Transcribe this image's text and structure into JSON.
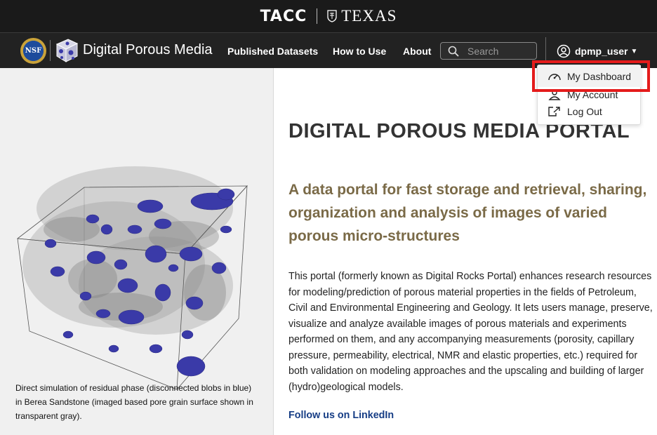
{
  "topbar": {
    "tacc_logo": "TACC",
    "texas_logo": "TEXAS"
  },
  "nav": {
    "nsf_logo": "NSF",
    "brand_title": "Digital Porous Media",
    "links": {
      "published": "Published Datasets",
      "howto": "How to Use",
      "about": "About"
    },
    "search": {
      "placeholder": "Search"
    },
    "user": "dpmp_user"
  },
  "dropdown": {
    "items": [
      {
        "label": "My Dashboard",
        "icon": "dashboard-gauge-icon"
      },
      {
        "label": "My Account",
        "icon": "account-icon"
      },
      {
        "label": "Log Out",
        "icon": "logout-icon"
      }
    ]
  },
  "left": {
    "caption": "Direct simulation of residual phase (disconnected blobs in blue) in Berea Sandstone (imaged based pore grain surface shown in transparent gray)."
  },
  "main": {
    "title": "DIGITAL POROUS MEDIA PORTAL",
    "subtitle": "A data portal for fast storage and retrieval, sharing, organization and analysis of images of varied porous micro-structures",
    "body": "This portal (formerly known as Digital Rocks Portal) enhances research resources for modeling/prediction of porous material properties in the fields of Petroleum, Civil and Environmental Engineering and Geology. It lets users manage, preserve, visualize and analyze available images of porous materials and experiments performed on them, and any accompanying measurements (porosity, capillary pressure, permeability, electrical, NMR and elastic properties, etc.) required for both validation on modeling approaches and the upscaling and building of larger (hydro)geological models.",
    "linkedin": "Follow us on LinkedIn"
  },
  "colors": {
    "accent_subtitle": "#7a6a47",
    "link": "#163d85",
    "highlight": "#e41b1b",
    "blob_blue": "#3a3aa8"
  }
}
